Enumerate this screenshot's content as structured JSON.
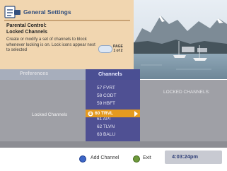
{
  "header": {
    "title": "General Settings",
    "heading_line1": "Parental Control:",
    "heading_line2": "Locked Channels",
    "description": "Create or modify a set of channels to block whenever locking is on. Lock icons appear next to selected",
    "page_label_line1": "PAGE",
    "page_label_line2": "1 of 2"
  },
  "tabs": [
    {
      "label": "Preferences",
      "active": false
    },
    {
      "label": "Channels",
      "active": true
    }
  ],
  "main": {
    "left_label": "Locked Channels",
    "right_header": "LOCKED CHANNELS:",
    "channels": [
      "57 FVRT",
      "58 CODT",
      "59 HBFT",
      "60 TRVL",
      "61 API",
      "62 TLVN",
      "63 BALU"
    ],
    "selected_channel": "60 TRVL",
    "selected_index": 3
  },
  "footer": {
    "add_label": "Add Channel",
    "exit_label": "Exit",
    "clock": "4:03:24pm"
  },
  "colors": {
    "header_bg": "#f1d6b0",
    "channel_list_bg": "#4f5093",
    "highlight": "#e49a20",
    "content_bg": "#9fa0a6",
    "add_button": "#3d66c6",
    "exit_button": "#6e9a3c"
  }
}
